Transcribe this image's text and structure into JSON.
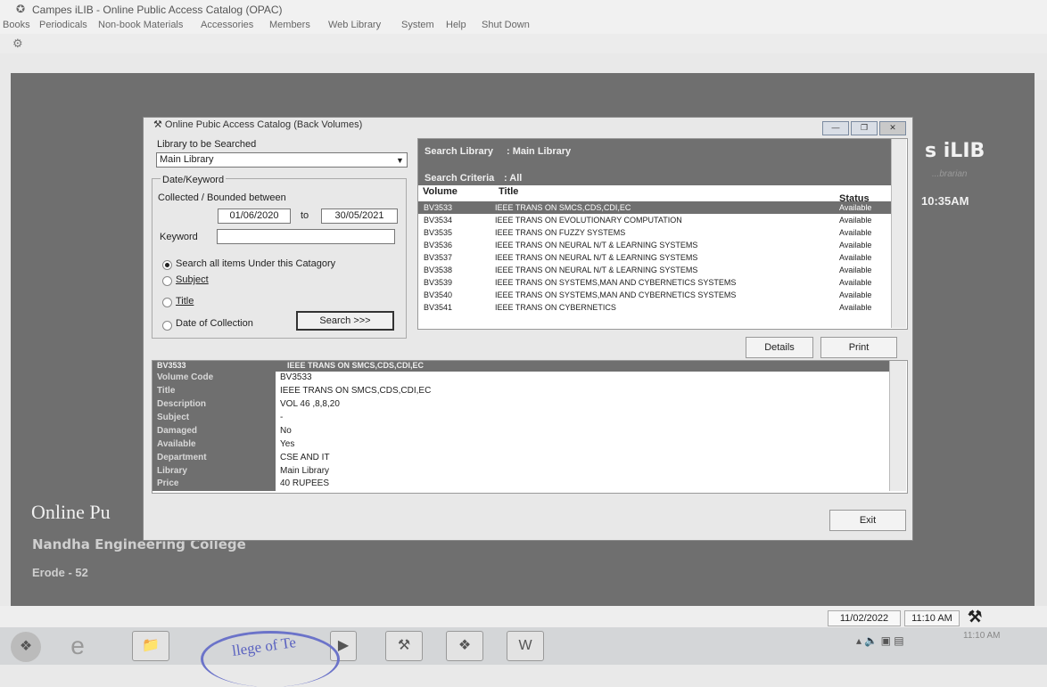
{
  "app": {
    "title": "Campes iLIB - Online Public Access Catalog (OPAC)",
    "menu": [
      "Books",
      "Periodicals",
      "Non-book Materials",
      "Accessories",
      "Members",
      "Web Library",
      "System",
      "Help",
      "Shut Down"
    ]
  },
  "background": {
    "brand": "s iLIB",
    "subtitle": "...brarian",
    "time": "10:35AM",
    "online_text": "Online Pu",
    "college": "Nandha Engineering College",
    "city": "Erode - 52"
  },
  "dialog": {
    "title": "Online Pubic Access Catalog (Back Volumes)",
    "library_label": "Library to be Searched",
    "library_value": "Main Library",
    "group_label": "Date/Keyword",
    "collected_label": "Collected / Bounded between",
    "date_from": "01/06/2020",
    "to_label": "to",
    "date_to": "30/05/2021",
    "keyword_label": "Keyword",
    "keyword_value": "",
    "options": [
      {
        "label": "Search all items Under this Catagory",
        "selected": true
      },
      {
        "label": "Subject",
        "selected": false
      },
      {
        "label": "Title",
        "selected": false
      },
      {
        "label": "Date of Collection",
        "selected": false
      }
    ],
    "search_button": "Search >>>",
    "results": {
      "search_library_label": "Search Library",
      "search_library_value": ": Main Library",
      "criteria_label": "Search Criteria",
      "criteria_value": ": All",
      "columns": [
        "Volume",
        "Title",
        "Status"
      ],
      "rows": [
        {
          "volume": "BV3533",
          "title": "IEEE TRANS ON SMCS,CDS,CDI,EC",
          "status": "Available",
          "selected": true
        },
        {
          "volume": "BV3534",
          "title": "IEEE TRANS ON EVOLUTIONARY COMPUTATION",
          "status": "Available"
        },
        {
          "volume": "BV3535",
          "title": "IEEE TRANS ON FUZZY SYSTEMS",
          "status": "Available"
        },
        {
          "volume": "BV3536",
          "title": "IEEE TRANS ON NEURAL N/T & LEARNING SYSTEMS",
          "status": "Available"
        },
        {
          "volume": "BV3537",
          "title": "IEEE TRANS ON NEURAL N/T & LEARNING SYSTEMS",
          "status": "Available"
        },
        {
          "volume": "BV3538",
          "title": "IEEE TRANS ON NEURAL N/T & LEARNING SYSTEMS",
          "status": "Available"
        },
        {
          "volume": "BV3539",
          "title": "IEEE TRANS ON SYSTEMS,MAN AND CYBERNETICS SYSTEMS",
          "status": "Available"
        },
        {
          "volume": "BV3540",
          "title": "IEEE TRANS ON SYSTEMS,MAN AND CYBERNETICS SYSTEMS",
          "status": "Available"
        },
        {
          "volume": "BV3541",
          "title": "IEEE TRANS ON CYBERNETICS",
          "status": "Available"
        }
      ]
    },
    "details_button": "Details",
    "print_button": "Print",
    "detail": {
      "header_code": "BV3533",
      "header_title": "IEEE TRANS ON SMCS,CDS,CDI,EC",
      "fields": [
        {
          "label": "Volume Code",
          "value": "BV3533"
        },
        {
          "label": "Title",
          "value": "IEEE TRANS ON SMCS,CDS,CDI,EC"
        },
        {
          "label": "Description",
          "value": "VOL 46 ,8,8,20"
        },
        {
          "label": "Subject",
          "value": "-"
        },
        {
          "label": "Damaged",
          "value": "No"
        },
        {
          "label": "Available",
          "value": "Yes"
        },
        {
          "label": "Department",
          "value": "CSE AND IT"
        },
        {
          "label": "Library",
          "value": "Main Library"
        },
        {
          "label": "Price",
          "value": "40 RUPEES"
        }
      ]
    },
    "exit_button": "Exit"
  },
  "status": {
    "date": "11/02/2022",
    "time": "11:10 AM"
  },
  "taskbar": {
    "clock_time": "11:10 AM",
    "stamp_text": "llege of Te"
  }
}
